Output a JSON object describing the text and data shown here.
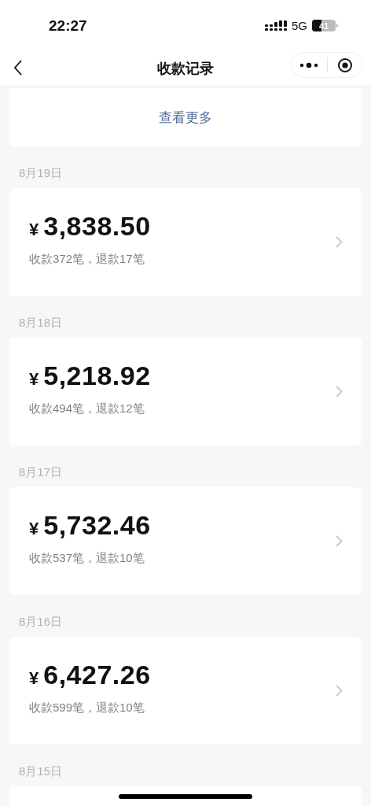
{
  "status_bar": {
    "time": "22:27",
    "network": "5G",
    "battery": "41"
  },
  "nav_bar": {
    "title": "收款记录"
  },
  "more_link": "查看更多",
  "days": [
    {
      "date": "8月19日",
      "currency": "¥",
      "amount": "3,838.50",
      "summary": "收款372笔，退款17笔"
    },
    {
      "date": "8月18日",
      "currency": "¥",
      "amount": "5,218.92",
      "summary": "收款494笔，退款12笔"
    },
    {
      "date": "8月17日",
      "currency": "¥",
      "amount": "5,732.46",
      "summary": "收款537笔，退款10笔"
    },
    {
      "date": "8月16日",
      "currency": "¥",
      "amount": "6,427.26",
      "summary": "收款599笔，退款10笔"
    },
    {
      "date": "8月15日"
    }
  ]
}
